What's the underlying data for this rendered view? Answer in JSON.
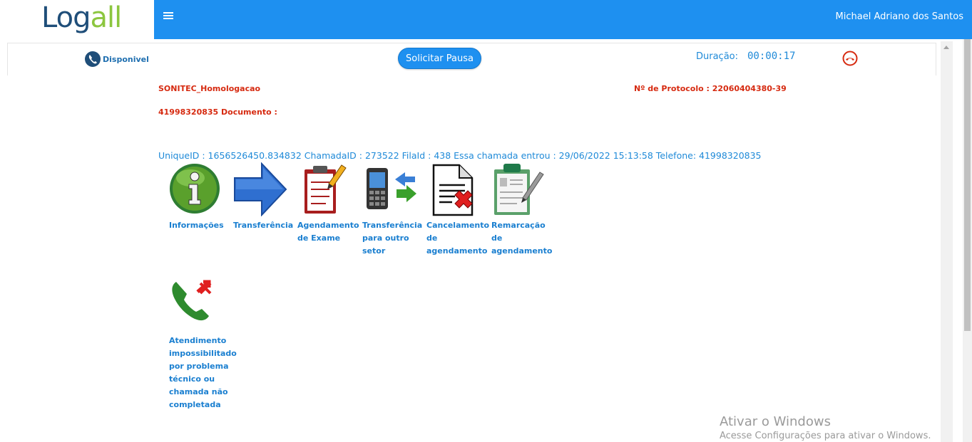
{
  "header": {
    "logo_text": "Logall",
    "logo_parts": [
      "Lo",
      "g",
      "all"
    ],
    "user_name": "Michael Adriano dos Santos",
    "bar_color": "#1e90f0"
  },
  "call_bar": {
    "status_label": "Disponivel",
    "pause_button": "Solicitar Pausa",
    "duration_label": "Duração:",
    "duration_value": "00:00:17"
  },
  "call_info": {
    "campaign": "SONITEC_Homologacao",
    "protocol": "Nº de Protocolo : 22060404380-39",
    "phone_document": "41998320835 Documento :",
    "details": "UniqueID : 1656526450.834832 ChamadaID : 273522 FilaId : 438 Essa chamada entrou : 29/06/2022 15:13:58 Telefone: 41998320835"
  },
  "actions": [
    {
      "label": "Informações",
      "icon": "info-icon"
    },
    {
      "label": "Transferência",
      "icon": "arrow-right-icon"
    },
    {
      "label": "Agendamento de Exame",
      "icon": "clipboard-pencil-icon"
    },
    {
      "label": "Transferência para outro setor",
      "icon": "phone-transfer-icon"
    },
    {
      "label": "Cancelamento de agendamento",
      "icon": "document-cancel-icon"
    },
    {
      "label": "Remarcação de agendamento",
      "icon": "clipboard-edit-icon"
    },
    {
      "label": "Atendimento impossibilitado por problema técnico ou chamada não completada",
      "icon": "phone-failed-icon"
    }
  ],
  "watermark": {
    "title": "Ativar o Windows",
    "subtitle": "Acesse Configurações para ativar o Windows."
  },
  "colors": {
    "accent": "#1e90f0",
    "link": "#1a7fd0",
    "alert": "#d62a10"
  }
}
